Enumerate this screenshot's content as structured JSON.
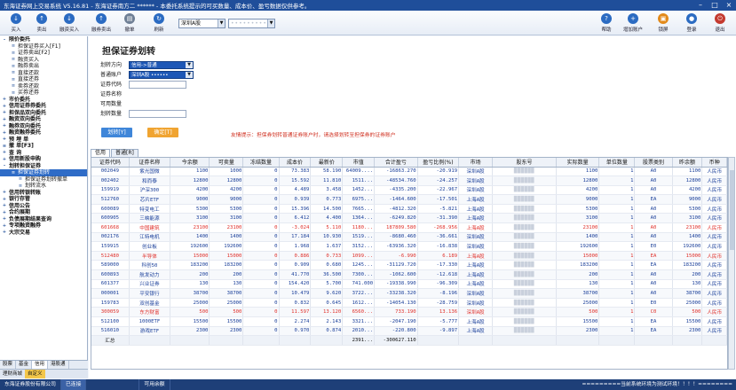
{
  "window": {
    "title": "东海证券网上交易系统 V5.16.81 - 东海证券南方二  ****** - 本委托系统提示的可买数量、成本价、盈亏数据仅供参考。"
  },
  "toolbar": {
    "buttons": [
      {
        "label": "买入",
        "icon": "buy-icon"
      },
      {
        "label": "卖出",
        "icon": "sell-icon"
      },
      {
        "label": "融资买入",
        "icon": "margin-buy-icon"
      },
      {
        "label": "融券卖出",
        "icon": "short-sell-icon"
      },
      {
        "label": "撤单",
        "icon": "cancel-order-icon"
      },
      {
        "label": "刷新",
        "icon": "refresh-icon"
      }
    ],
    "right_buttons": [
      {
        "label": "帮助",
        "icon": "help-icon"
      },
      {
        "label": "增加账户",
        "icon": "add-account-icon"
      },
      {
        "label": "锁屏",
        "icon": "lock-icon"
      },
      {
        "label": "登录",
        "icon": "login-icon"
      },
      {
        "label": "退出",
        "icon": "exit-icon"
      }
    ],
    "market_select": "深圳A股",
    "account_select": "••••••••••"
  },
  "sidebar": {
    "items": [
      {
        "label": "限价委托",
        "level": 0,
        "icon": "-"
      },
      {
        "label": "担保证券买入[F1]",
        "level": 1,
        "icon": "≡"
      },
      {
        "label": "证券卖出[F2]",
        "level": 1,
        "icon": "≡"
      },
      {
        "label": "融资买入",
        "level": 1,
        "icon": "≡"
      },
      {
        "label": "融券卖出",
        "level": 1,
        "icon": "≡"
      },
      {
        "label": "直接还款",
        "level": 1,
        "icon": "≡"
      },
      {
        "label": "直接还券",
        "level": 1,
        "icon": "≡"
      },
      {
        "label": "卖券还款",
        "level": 1,
        "icon": "≡"
      },
      {
        "label": "买券还券",
        "level": 1,
        "icon": "≡"
      },
      {
        "label": "市价委托",
        "level": 0,
        "icon": "+"
      },
      {
        "label": "信用证券券委托",
        "level": 0,
        "icon": "+"
      },
      {
        "label": "担保品双向委托",
        "level": 0,
        "icon": "+"
      },
      {
        "label": "融资双向委托",
        "level": 0,
        "icon": "+"
      },
      {
        "label": "融券双向委托",
        "level": 0,
        "icon": "+"
      },
      {
        "label": "融资融券委托",
        "level": 0,
        "icon": "+"
      },
      {
        "label": "预 埋 单",
        "level": 0,
        "icon": "+"
      },
      {
        "label": "撤 单[F3]",
        "level": 0,
        "icon": "≡"
      },
      {
        "label": "查 询",
        "level": 0,
        "icon": "+"
      },
      {
        "label": "信用新股申购",
        "level": 0,
        "icon": "+"
      },
      {
        "label": "划转担保证券",
        "level": 0,
        "icon": "-"
      },
      {
        "label": "担保证券划转",
        "level": 1,
        "icon": "≡",
        "selected": true
      },
      {
        "label": "担保证券划转撤单",
        "level": 2,
        "icon": "≡"
      },
      {
        "label": "划转流水",
        "level": 2,
        "icon": "≡"
      },
      {
        "label": "信用转银转账",
        "level": 0,
        "icon": "+"
      },
      {
        "label": "银行存管",
        "level": 0,
        "icon": "+"
      },
      {
        "label": "信用公告",
        "level": 0,
        "icon": "+"
      },
      {
        "label": "合约展期",
        "level": 0,
        "icon": "+"
      },
      {
        "label": "负债展期结果查询",
        "level": 0,
        "icon": "+"
      },
      {
        "label": "专项融资融券",
        "level": 0,
        "icon": "+"
      },
      {
        "label": "大宗交易",
        "level": 0,
        "icon": "+"
      }
    ],
    "tabs": [
      "股票",
      "基金",
      "信用",
      "港股通"
    ],
    "active_tab": "信用",
    "footer": [
      "理财商城",
      "自定义"
    ]
  },
  "form": {
    "title": "担保证券划转",
    "direction_label": "划转方向",
    "direction_value": "信用->普通",
    "account_label": "普通账户",
    "account_value": "深圳A股 ••••••",
    "code_label": "证券代码",
    "name_label": "证券名称",
    "avail_label": "可用数量",
    "qty_label": "划转数量",
    "confirm_label": "划转[Y]",
    "reset_label": "确定[T]",
    "hint": "友情提示：担保券划转普通证券账户时，请选择划转至担保券的证券账户"
  },
  "grid": {
    "tabs": [
      "信用",
      "普通[R]"
    ],
    "active_tab": "信用",
    "columns": [
      "证券代码",
      "证券名称",
      "今余额",
      "可卖量",
      "冻结数量",
      "成本价",
      "最新价",
      "市值",
      "合计盈亏",
      "盈亏比例(%)",
      "市场",
      "股东号",
      "实际数量",
      "单位数量",
      "股票类别",
      "昨余额",
      "币种"
    ],
    "rows": [
      {
        "code": "002049",
        "name": "紫光国微",
        "bal": "1100",
        "avail": "1000",
        "frozen": "0",
        "cost": "73.383",
        "price": "58.190",
        "mv": "64009....",
        "pnl": "-16863.270",
        "pct": "-20.919",
        "mkt": "深圳A股",
        "qty": "1100",
        "unit": "1",
        "type": "A0",
        "ybal": "1100",
        "cur": "人民币",
        "color": "blue"
      },
      {
        "code": "002402",
        "name": "和而泰",
        "bal": "12800",
        "avail": "12800",
        "frozen": "0",
        "cost": "15.592",
        "price": "11.810",
        "mv": "1511...",
        "pnl": "-48534.760",
        "pct": "-24.257",
        "mkt": "深圳A股",
        "qty": "12800",
        "unit": "1",
        "type": "A0",
        "ybal": "12800",
        "cur": "人民币",
        "color": "blue"
      },
      {
        "code": "159919",
        "name": "沪深300",
        "bal": "4200",
        "avail": "4200",
        "frozen": "0",
        "cost": "4.489",
        "price": "3.458",
        "mv": "1452...",
        "pnl": "-4335.200",
        "pct": "-22.967",
        "mkt": "深圳A股",
        "qty": "4200",
        "unit": "1",
        "type": "A0",
        "ybal": "4200",
        "cur": "人民币",
        "color": "blue"
      },
      {
        "code": "512760",
        "name": "芯片ETF",
        "bal": "9000",
        "avail": "9000",
        "frozen": "0",
        "cost": "0.939",
        "price": "0.773",
        "mv": "6975...",
        "pnl": "-1464.600",
        "pct": "-17.501",
        "mkt": "上海A股",
        "qty": "9000",
        "unit": "1",
        "type": "EA",
        "ybal": "9000",
        "cur": "人民币",
        "color": "blue"
      },
      {
        "code": "600089",
        "name": "特变电工",
        "bal": "5300",
        "avail": "5300",
        "frozen": "0",
        "cost": "15.396",
        "price": "14.500",
        "mv": "7665...",
        "pnl": "-4812.320",
        "pct": "-5.821",
        "mkt": "上海A股",
        "qty": "5300",
        "unit": "1",
        "type": "A0",
        "ybal": "5300",
        "cur": "人民币",
        "color": "blue"
      },
      {
        "code": "600905",
        "name": "三峡能源",
        "bal": "3100",
        "avail": "3100",
        "frozen": "0",
        "cost": "6.412",
        "price": "4.400",
        "mv": "1364...",
        "pnl": "-6249.820",
        "pct": "-31.390",
        "mkt": "上海A股",
        "qty": "3100",
        "unit": "1",
        "type": "A0",
        "ybal": "3100",
        "cur": "人民币",
        "color": "blue"
      },
      {
        "code": "601668",
        "name": "中国建筑",
        "bal": "23100",
        "avail": "23100",
        "frozen": "0",
        "cost": "-3.024",
        "price": "5.110",
        "mv": "1180...",
        "pnl": "187809.580",
        "pct": "-268.956",
        "mkt": "上海A股",
        "qty": "23100",
        "unit": "1",
        "type": "A0",
        "ybal": "23100",
        "cur": "人民币",
        "color": "red"
      },
      {
        "code": "002176",
        "name": "江特电机",
        "bal": "1400",
        "avail": "1400",
        "frozen": "0",
        "cost": "17.184",
        "price": "10.930",
        "mv": "1519...",
        "pnl": "-8680.460",
        "pct": "-36.661",
        "mkt": "深圳A股",
        "qty": "1400",
        "unit": "1",
        "type": "A0",
        "ybal": "1400",
        "cur": "人民币",
        "color": "blue"
      },
      {
        "code": "159915",
        "name": "创业板",
        "bal": "192600",
        "avail": "192600",
        "frozen": "0",
        "cost": "1.968",
        "price": "1.637",
        "mv": "3152...",
        "pnl": "-63936.320",
        "pct": "-16.838",
        "mkt": "深圳A股",
        "qty": "192600",
        "unit": "1",
        "type": "E0",
        "ybal": "192600",
        "cur": "人民币",
        "color": "blue"
      },
      {
        "code": "512480",
        "name": "半导体",
        "bal": "15000",
        "avail": "15000",
        "frozen": "0",
        "cost": "0.886",
        "price": "0.733",
        "mv": "1099...",
        "pnl": "-6.990",
        "pct": "6.189",
        "mkt": "上海A股",
        "qty": "15000",
        "unit": "1",
        "type": "EA",
        "ybal": "15000",
        "cur": "人民币",
        "color": "red"
      },
      {
        "code": "589000",
        "name": "科创50",
        "bal": "183200",
        "avail": "183200",
        "frozen": "0",
        "cost": "0.909",
        "price": "0.680",
        "mv": "1245...",
        "pnl": "-31129.720",
        "pct": "-17.330",
        "mkt": "上海A股",
        "qty": "183200",
        "unit": "1",
        "type": "EA",
        "ybal": "183200",
        "cur": "人民币",
        "color": "blue"
      },
      {
        "code": "600893",
        "name": "航发动力",
        "bal": "200",
        "avail": "200",
        "frozen": "0",
        "cost": "41.770",
        "price": "36.500",
        "mv": "7300...",
        "pnl": "-1062.600",
        "pct": "-12.618",
        "mkt": "上海A股",
        "qty": "200",
        "unit": "1",
        "type": "A0",
        "ybal": "200",
        "cur": "人民币",
        "color": "blue"
      },
      {
        "code": "601377",
        "name": "兴业证券",
        "bal": "130",
        "avail": "130",
        "frozen": "0",
        "cost": "154.420",
        "price": "5.700",
        "mv": "741.000",
        "pnl": "-19338.990",
        "pct": "-96.309",
        "mkt": "上海A股",
        "qty": "130",
        "unit": "1",
        "type": "A0",
        "ybal": "130",
        "cur": "人民币",
        "color": "blue"
      },
      {
        "code": "000001",
        "name": "平安银行",
        "bal": "38700",
        "avail": "38700",
        "frozen": "0",
        "cost": "10.479",
        "price": "9.620",
        "mv": "3722...",
        "pnl": "-33238.320",
        "pct": "-8.196",
        "mkt": "深圳A股",
        "qty": "38700",
        "unit": "1",
        "type": "A0",
        "ybal": "38700",
        "cur": "人民币",
        "color": "blue"
      },
      {
        "code": "159783",
        "name": "双创基金",
        "bal": "25000",
        "avail": "25000",
        "frozen": "0",
        "cost": "0.832",
        "price": "0.645",
        "mv": "1612...",
        "pnl": "-14054.130",
        "pct": "-28.759",
        "mkt": "深圳A股",
        "qty": "25000",
        "unit": "1",
        "type": "E0",
        "ybal": "25000",
        "cur": "人民币",
        "color": "blue"
      },
      {
        "code": "300059",
        "name": "东方财富",
        "bal": "500",
        "avail": "500",
        "frozen": "0",
        "cost": "11.597",
        "price": "13.120",
        "mv": "6560...",
        "pnl": "733.190",
        "pct": "13.136",
        "mkt": "深圳A股",
        "qty": "500",
        "unit": "1",
        "type": "C0",
        "ybal": "500",
        "cur": "人民币",
        "color": "red"
      },
      {
        "code": "512100",
        "name": "1000ETF",
        "bal": "15500",
        "avail": "15500",
        "frozen": "0",
        "cost": "2.274",
        "price": "2.143",
        "mv": "3321...",
        "pnl": "-2047.190",
        "pct": "-5.777",
        "mkt": "上海A股",
        "qty": "15500",
        "unit": "1",
        "type": "EA",
        "ybal": "15500",
        "cur": "人民币",
        "color": "blue"
      },
      {
        "code": "516010",
        "name": "游戏ETF",
        "bal": "2300",
        "avail": "2300",
        "frozen": "0",
        "cost": "0.970",
        "price": "0.874",
        "mv": "2010...",
        "pnl": "-220.800",
        "pct": "-9.897",
        "mkt": "上海A股",
        "qty": "2300",
        "unit": "1",
        "type": "EA",
        "ybal": "2300",
        "cur": "人民币",
        "color": "blue"
      }
    ],
    "summary": {
      "label": "汇总",
      "mv": "2391...",
      "pnl": "-300627.110"
    }
  },
  "statusbar": {
    "company": "东海证券股份有限公司",
    "hl": "已连接",
    "avail_label": "可用余额",
    "notice": "=========当前系统环境为测试环境！！！！========"
  }
}
